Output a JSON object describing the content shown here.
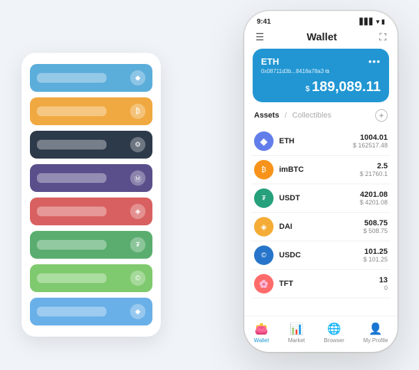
{
  "scene": {
    "background": "#f0f4f8"
  },
  "cardStack": {
    "cards": [
      {
        "color": "color-blue",
        "id": "card-blue"
      },
      {
        "color": "color-orange",
        "id": "card-orange"
      },
      {
        "color": "color-dark",
        "id": "card-dark"
      },
      {
        "color": "color-purple",
        "id": "card-purple"
      },
      {
        "color": "color-red",
        "id": "card-red"
      },
      {
        "color": "color-green",
        "id": "card-green"
      },
      {
        "color": "color-lightgreen",
        "id": "card-lightgreen"
      },
      {
        "color": "color-lightblue",
        "id": "card-lightblue"
      }
    ]
  },
  "phone": {
    "statusBar": {
      "time": "9:41",
      "signal": "▋▋▋",
      "wifi": "WiFi",
      "battery": "🔋"
    },
    "header": {
      "menuIcon": "☰",
      "title": "Wallet",
      "expandIcon": "⛶"
    },
    "ethCard": {
      "label": "ETH",
      "address": "0x08711d3b...8418a78a3",
      "copyIcon": "⧉",
      "dotsLabel": "•••",
      "currencySymbol": "$",
      "balance": "189,089.11"
    },
    "assetsSection": {
      "activeTab": "Assets",
      "divider": "/",
      "inactiveTab": "Collectibles",
      "addLabel": "+"
    },
    "assets": [
      {
        "symbol": "ETH",
        "iconBg": "#627eea",
        "iconText": "◆",
        "amount": "1004.01",
        "usdValue": "$ 162517.48"
      },
      {
        "symbol": "imBTC",
        "iconBg": "#f7931a",
        "iconText": "₿",
        "amount": "2.5",
        "usdValue": "$ 21760.1"
      },
      {
        "symbol": "USDT",
        "iconBg": "#26a17b",
        "iconText": "₮",
        "amount": "4201.08",
        "usdValue": "$ 4201.08"
      },
      {
        "symbol": "DAI",
        "iconBg": "#f5ac37",
        "iconText": "◈",
        "amount": "508.75",
        "usdValue": "$ 508.75"
      },
      {
        "symbol": "USDC",
        "iconBg": "#2775ca",
        "iconText": "©",
        "amount": "101.25",
        "usdValue": "$ 101.25"
      },
      {
        "symbol": "TFT",
        "iconBg": "#ff6b6b",
        "iconText": "🌸",
        "amount": "13",
        "usdValue": "0"
      }
    ],
    "bottomNav": [
      {
        "icon": "👛",
        "label": "Wallet",
        "active": true
      },
      {
        "icon": "📊",
        "label": "Market",
        "active": false
      },
      {
        "icon": "🌐",
        "label": "Browser",
        "active": false
      },
      {
        "icon": "👤",
        "label": "My Profile",
        "active": false
      }
    ]
  }
}
